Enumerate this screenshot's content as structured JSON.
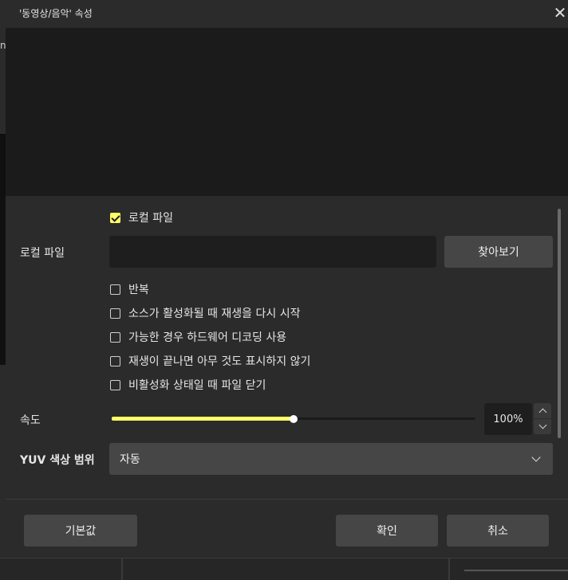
{
  "background": {
    "glyph": "n"
  },
  "dialog": {
    "title": "'동영상/음악' 속성",
    "close_symbol": "✕"
  },
  "form": {
    "local_file_checkbox": {
      "label": "로컬 파일",
      "checked": true
    },
    "local_file_field": {
      "label": "로컬 파일",
      "value": "",
      "placeholder": ""
    },
    "browse_button": "찾아보기",
    "options": [
      {
        "label": "반복",
        "checked": false
      },
      {
        "label": "소스가 활성화될 때 재생을 다시 시작",
        "checked": false
      },
      {
        "label": "가능한 경우 하드웨어 디코딩 사용",
        "checked": false
      },
      {
        "label": "재생이 끝나면 아무 것도 표시하지 않기",
        "checked": false
      },
      {
        "label": "비활성화 상태일 때 파일 닫기",
        "checked": false
      }
    ],
    "speed": {
      "label": "속도",
      "value_text": "100%",
      "fraction": 0.5
    },
    "yuv_range": {
      "label": "YUV 색상 범위",
      "selected": "자동"
    }
  },
  "footer": {
    "defaults_button": "기본값",
    "ok_button": "확인",
    "cancel_button": "취소"
  },
  "colors": {
    "accent": "#ffff66",
    "dialog_bg": "#2b2b2b",
    "preview_bg": "#1b1b1b",
    "button_bg": "#464646"
  }
}
